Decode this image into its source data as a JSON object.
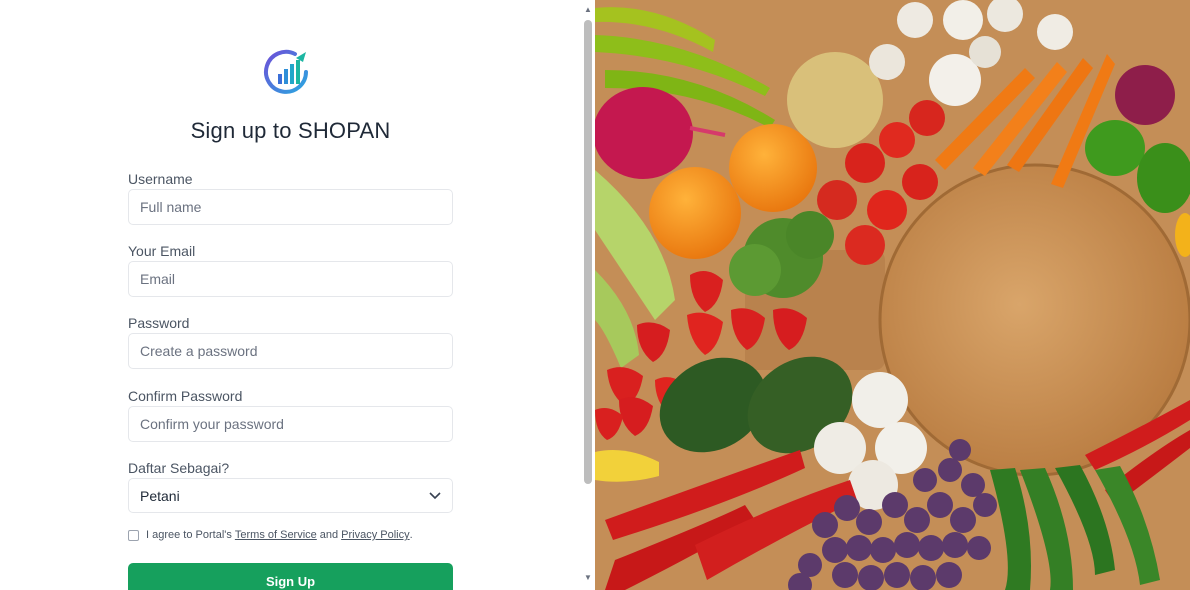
{
  "app": {
    "title": "Sign up to SHOPAN"
  },
  "form": {
    "username": {
      "label": "Username",
      "placeholder": "Full name"
    },
    "email": {
      "label": "Your Email",
      "placeholder": "Email"
    },
    "password": {
      "label": "Password",
      "placeholder": "Create a password"
    },
    "confirm": {
      "label": "Confirm Password",
      "placeholder": "Confirm your password"
    },
    "role": {
      "label": "Daftar Sebagai?",
      "value": "Petani"
    },
    "agree": {
      "prefix": "I agree to Portal's",
      "terms": "Terms of Service",
      "and": "and",
      "privacy": "Privacy Policy",
      "suffix": "."
    },
    "submit_label": "Sign Up"
  },
  "colors": {
    "accent": "#16a05d",
    "border": "#e5e7eb"
  },
  "icons": [
    "shopan-logo-icon",
    "chevron-down-icon",
    "scroll-up-icon",
    "scroll-down-icon"
  ]
}
